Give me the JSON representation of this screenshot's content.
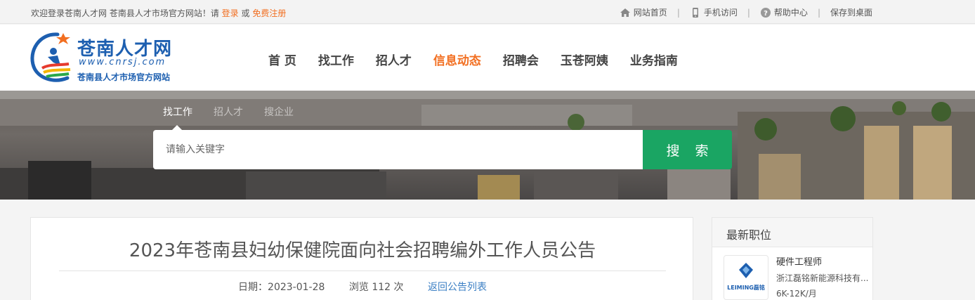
{
  "topbar": {
    "welcome_text": "欢迎登录苍南人才网 苍南县人才市场官方网站！请",
    "login": "登录",
    "or": "或",
    "register": "免费注册",
    "links": [
      {
        "label": "网站首页",
        "icon": "home-icon"
      },
      {
        "label": "手机访问",
        "icon": "mobile-icon"
      },
      {
        "label": "帮助中心",
        "icon": "help-icon"
      },
      {
        "label": "保存到桌面",
        "icon": ""
      }
    ],
    "separator": "|"
  },
  "logo": {
    "title": "苍南人才网",
    "url": "www.cnrsj.com",
    "slogan": "苍南县人才市场官方网站"
  },
  "nav": {
    "items": [
      "首 页",
      "找工作",
      "招人才",
      "信息动态",
      "招聘会",
      "玉苍阿姨",
      "业务指南"
    ],
    "active": "信息动态"
  },
  "search": {
    "tabs": [
      "找工作",
      "招人才",
      "搜企业"
    ],
    "active_tab": "找工作",
    "placeholder": "请输入关键字",
    "button": "搜 索"
  },
  "article": {
    "title": "2023年苍南县妇幼保健院面向社会招聘编外工作人员公告",
    "date_label": "日期：",
    "date": "2023-01-28",
    "views_label": "浏览",
    "views": "112",
    "views_unit": "次",
    "back_link": "返回公告列表"
  },
  "sidebar": {
    "heading": "最新职位",
    "jobs": [
      {
        "title": "硬件工程师",
        "company": "浙江磊铭新能源科技有...",
        "salary": "6K-12K/月",
        "logo_text": "LEIMING磊铭"
      }
    ]
  },
  "colors": {
    "accent": "#f26f21",
    "brand_blue": "#1d5fb0",
    "search_green": "#1aa563"
  }
}
